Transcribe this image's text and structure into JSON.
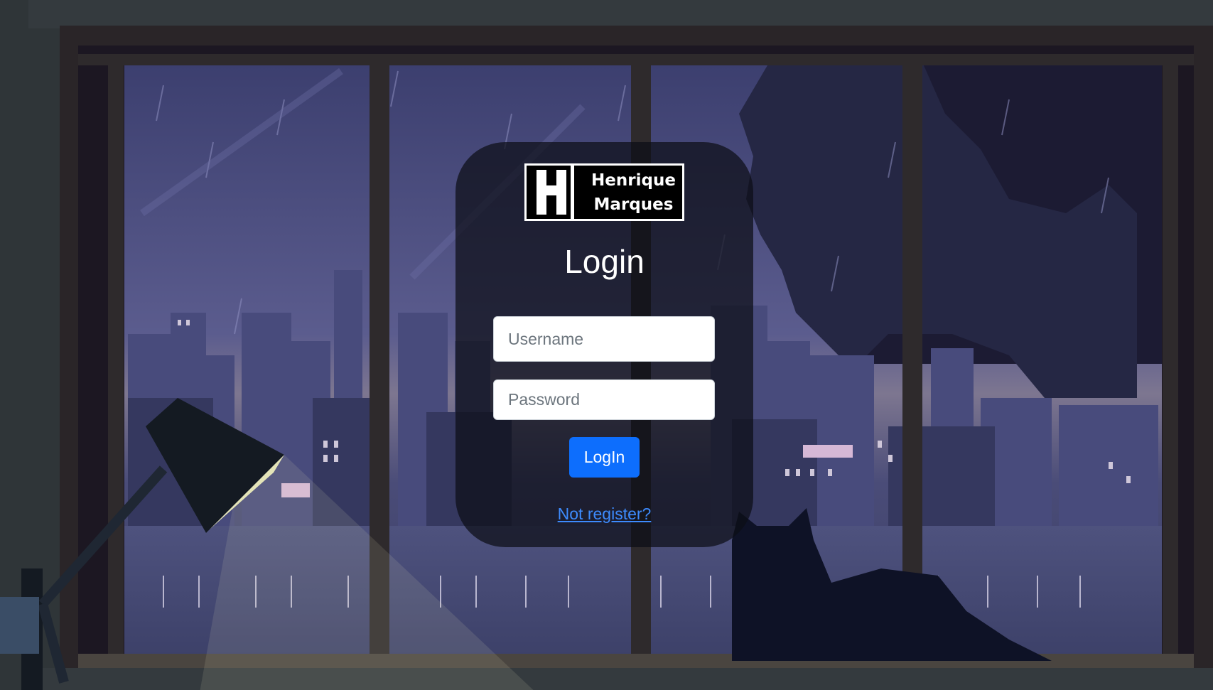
{
  "brand": {
    "line1": "Henrique",
    "line2": "Marques"
  },
  "login": {
    "title": "Login",
    "username_placeholder": "Username",
    "password_placeholder": "Password",
    "submit_label": "LogIn",
    "register_link": "Not register?"
  },
  "colors": {
    "primary": "#0d6efd",
    "link": "#3d8bfd",
    "card_bg": "rgba(12,14,22,0.72)"
  }
}
